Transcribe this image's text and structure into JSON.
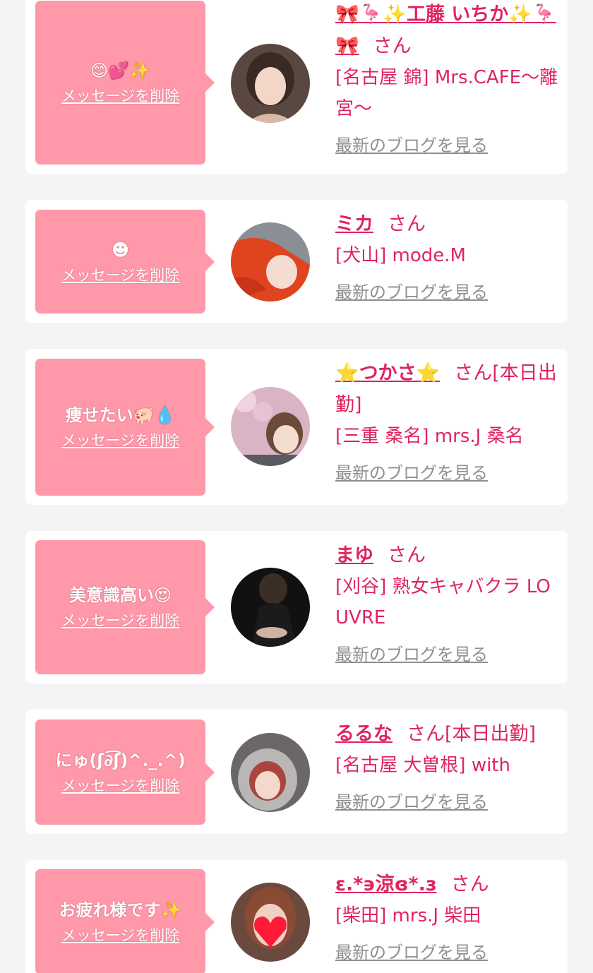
{
  "delete_label": "メッセージを削除",
  "blog_label": "最新のブログを見る",
  "honorific": "さん",
  "colors": {
    "background": "#f4f4f4",
    "card": "#ffffff",
    "bubble": "#ff99aa",
    "accent": "#e0245e",
    "link_gray": "#8f8f8f"
  },
  "favorites": [
    {
      "message": "😊💕✨",
      "name": "🎀🦩✨工藤 いちか✨🦩🎀",
      "status": "",
      "shop": "[名古屋 錦] Mrs.CAFE〜離宮〜",
      "avatar_icon": "avatar-photo-icon"
    },
    {
      "message": "☻",
      "name": "ミカ",
      "status": "",
      "shop": "[犬山] mode.M",
      "avatar_icon": "avatar-photo-icon"
    },
    {
      "message": "痩せたい🐖💧",
      "name": "⭐️つかさ⭐️",
      "status": "[本日出勤]",
      "shop": "[三重 桑名] mrs.J 桑名",
      "avatar_icon": "avatar-photo-icon"
    },
    {
      "message": "美意識高い😍",
      "name": "まゆ",
      "status": "",
      "shop": "[刈谷] 熟女キャバクラ LOUVRE",
      "avatar_icon": "avatar-photo-icon"
    },
    {
      "message": "にゅ(ʃ∂͡ʃ)^._.^)",
      "name": "るるな",
      "status": "[本日出勤]",
      "shop": "[名古屋 大曽根] with",
      "avatar_icon": "avatar-photo-icon"
    },
    {
      "message": "お疲れ様です✨",
      "name": "ε.*϶涼ɞ*.з",
      "status": "",
      "shop": "[柴田] mrs.J 柴田",
      "avatar_icon": "avatar-photo-icon"
    }
  ]
}
